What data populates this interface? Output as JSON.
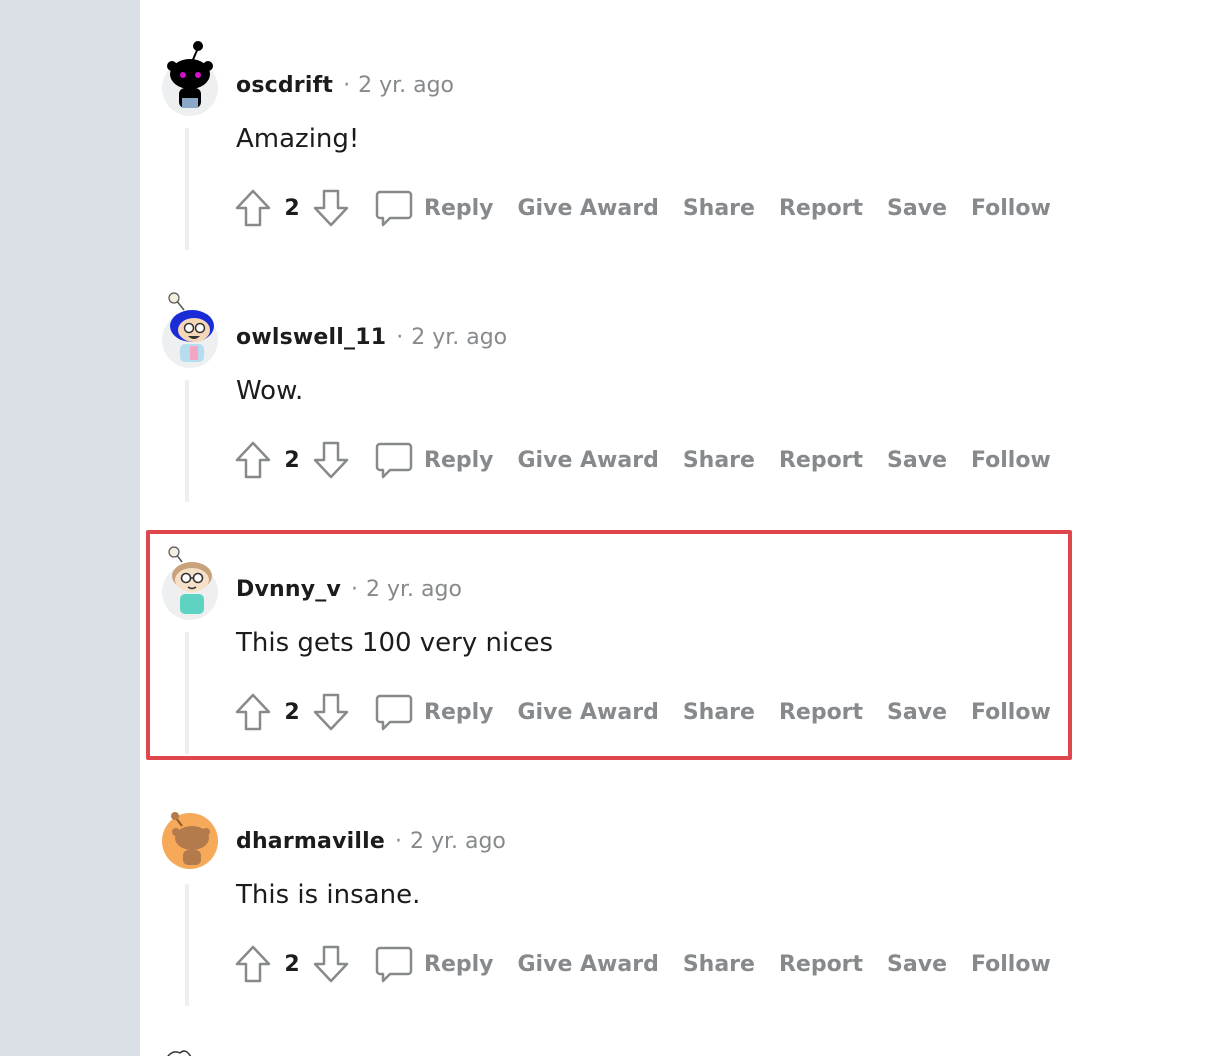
{
  "colors": {
    "gutter": "#dae0e6",
    "muted_text": "#878a8c",
    "highlight_border": "#e0474c",
    "thread_line": "#edeff1"
  },
  "action_labels": {
    "reply": "Reply",
    "give_award": "Give Award",
    "share": "Share",
    "report": "Report",
    "save": "Save",
    "follow": "Follow"
  },
  "comments": [
    {
      "username": "oscdrift",
      "separator": "·",
      "time": "2 yr. ago",
      "text": "Amazing!",
      "votes": "2",
      "avatar": "snoo-avatar-black"
    },
    {
      "username": "owlswell_11",
      "separator": "·",
      "time": "2 yr. ago",
      "text": "Wow.",
      "votes": "2",
      "avatar": "snoo-avatar-blue-hair"
    },
    {
      "username": "Dvnny_v",
      "separator": "·",
      "time": "2 yr. ago",
      "text": "This gets 100 very nices",
      "votes": "2",
      "avatar": "snoo-avatar-glasses",
      "highlighted": true
    },
    {
      "username": "dharmaville",
      "separator": "·",
      "time": "2 yr. ago",
      "text": "This is insane.",
      "votes": "2",
      "avatar": "snoo-avatar-default-orange"
    }
  ]
}
